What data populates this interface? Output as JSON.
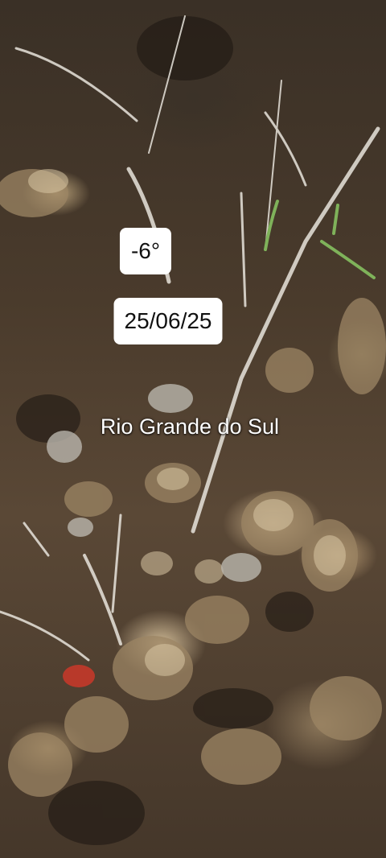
{
  "overlay": {
    "temperature": "-6°",
    "date": "25/06/25",
    "location": "Rio Grande do Sul"
  }
}
